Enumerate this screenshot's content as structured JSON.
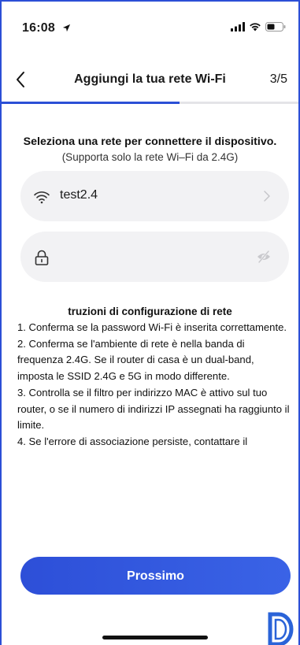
{
  "status_bar": {
    "time": "16:08",
    "location_icon": "location-arrow-icon",
    "signal_icon": "cellular-signal-icon",
    "wifi_icon": "wifi-icon",
    "battery_icon": "battery-icon"
  },
  "nav": {
    "back_icon": "chevron-left-icon",
    "title": "Aggiungi la tua rete Wi-Fi",
    "step": "3/5",
    "progress": 0.6
  },
  "heading": "Seleziona una rete per connettere il dispositivo.",
  "subheading": "(Supporta solo la rete Wi–Fi da 2.4G)",
  "ssid_field": {
    "icon": "wifi-icon",
    "value": "test2.4",
    "trailing_icon": "chevron-right-icon"
  },
  "password_field": {
    "icon": "lock-icon",
    "value": "",
    "placeholder": "",
    "trailing_icon": "eye-slash-icon"
  },
  "instructions": {
    "title": "truzioni di configurazione di rete",
    "items": [
      "1. Conferma se la password Wi-Fi è inserita correttamente.",
      "2. Conferma se l'ambiente di rete è nella banda di frequenza 2.4G. Se il router di casa è un dual-band, imposta le SSID 2.4G e 5G in modo differente.",
      "3. Controlla se il filtro per indirizzo MAC è attivo sul tuo router, o se il numero di indirizzi IP assegnati ha raggiunto il limite.",
      "4. Se l'errore di associazione persiste, contattare il"
    ]
  },
  "next_button": "Prossimo",
  "colors": {
    "accent": "#2b4fd6",
    "field_bg": "#f2f2f4"
  }
}
